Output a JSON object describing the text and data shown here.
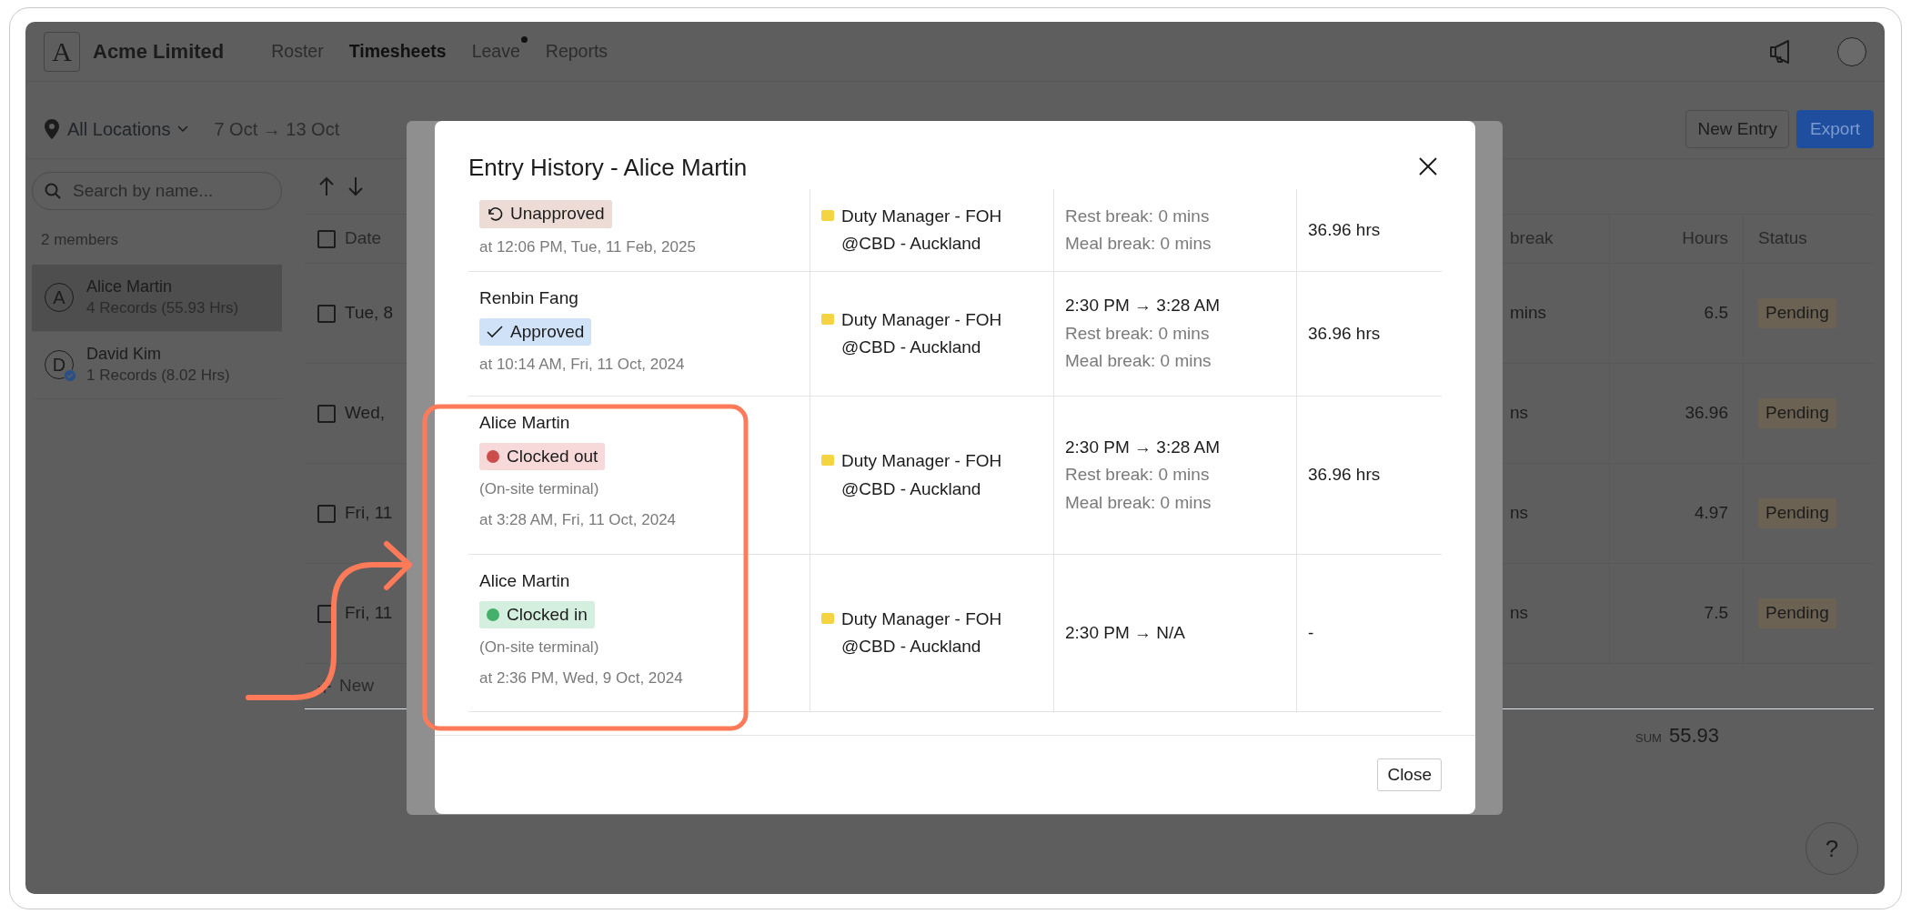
{
  "app": {
    "logo": "A",
    "brand": "Acme Limited",
    "nav": [
      {
        "label": "Roster",
        "selected": false,
        "dot": false
      },
      {
        "label": "Timesheets",
        "selected": true,
        "dot": false
      },
      {
        "label": "Leave",
        "selected": false,
        "dot": true
      },
      {
        "label": "Reports",
        "selected": false,
        "dot": false
      }
    ]
  },
  "toolbar": {
    "location": "All Locations",
    "date_range": "7 Oct → 13 Oct",
    "buttons": [
      {
        "label": "New Entry",
        "kind": "outline"
      },
      {
        "label": "Export",
        "kind": "primary"
      }
    ]
  },
  "sidebar": {
    "search": {
      "placeholder": "Search by name..."
    },
    "count": "2 members",
    "members": [
      {
        "initial": "A",
        "name": "Alice Martin",
        "records": "4 Records (55.93 Hrs)",
        "selected": true,
        "verified": false
      },
      {
        "initial": "D",
        "name": "David Kim",
        "records": "1 Records (8.02 Hrs)",
        "selected": false,
        "verified": true
      }
    ]
  },
  "table": {
    "header_checked": false,
    "columns": [
      {
        "label": "Date"
      },
      {
        "label": "break"
      },
      {
        "label": "Hours"
      },
      {
        "label": "Status"
      }
    ],
    "rows": [
      {
        "checked": false,
        "date": "Tue, 8",
        "break": "mins",
        "hours": "6.5",
        "status": "Pending"
      },
      {
        "checked": false,
        "date": "Wed,",
        "break": "ns",
        "hours": "36.96",
        "status": "Pending"
      },
      {
        "checked": false,
        "date": "Fri, 11",
        "break": "ns",
        "hours": "4.97",
        "status": "Pending"
      },
      {
        "checked": false,
        "date": "Fri, 11",
        "break": "ns",
        "hours": "7.5",
        "status": "Pending"
      }
    ],
    "add": "New",
    "sum_label": "SUM",
    "sum": "55.93"
  },
  "help": "?",
  "modal": {
    "title": "Entry History - Alice Martin",
    "entries": [
      {
        "status": {
          "kind": "unapproved",
          "label": "Unapproved"
        },
        "time": "at 12:06 PM, Tue, 11 Feb, 2025",
        "role": "Duty Manager - FOH",
        "location": "@CBD - Auckland",
        "breaks": [
          "Rest break: 0 mins",
          "Meal break: 0 mins"
        ],
        "hours": "36.96 hrs"
      },
      {
        "name": "Renbin Fang",
        "status": {
          "kind": "approved",
          "label": "Approved"
        },
        "time": "at 10:14 AM, Fri, 11 Oct, 2024",
        "role": "Duty Manager - FOH",
        "location": "@CBD - Auckland",
        "shift": "2:30 PM → 3:28 AM",
        "breaks": [
          "Rest break: 0 mins",
          "Meal break: 0 mins"
        ],
        "hours": "36.96 hrs"
      },
      {
        "name": "Alice Martin",
        "status": {
          "kind": "clocked_out",
          "label": "Clocked out"
        },
        "source": "(On-site terminal)",
        "time": "at 3:28 AM, Fri, 11 Oct, 2024",
        "role": "Duty Manager - FOH",
        "location": "@CBD - Auckland",
        "shift": "2:30 PM → 3:28 AM",
        "breaks": [
          "Rest break: 0 mins",
          "Meal break: 0 mins"
        ],
        "hours": "36.96 hrs"
      },
      {
        "name": "Alice Martin",
        "status": {
          "kind": "clocked_in",
          "label": "Clocked in"
        },
        "source": "(On-site terminal)",
        "time": "at 2:36 PM, Wed, 9 Oct, 2024",
        "role": "Duty Manager - FOH",
        "location": "@CBD - Auckland",
        "shift": "2:30 PM → N/A",
        "hours": "-"
      }
    ],
    "close": "Close"
  }
}
